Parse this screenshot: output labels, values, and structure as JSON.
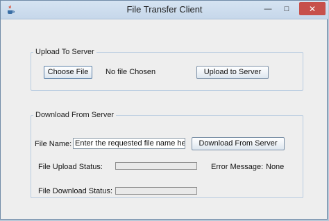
{
  "window": {
    "title": "File Transfer Client",
    "minimize_glyph": "—",
    "maximize_glyph": "□",
    "close_glyph": "✕"
  },
  "upload_section": {
    "legend": "Upload To Server",
    "choose_button": "Choose File",
    "file_status": "No file Chosen",
    "upload_button": "Upload to Server"
  },
  "download_section": {
    "legend": "Download From Server",
    "file_name_label": "File Name:",
    "file_name_value": "Enter the requested file name here",
    "download_button": "Download From Server",
    "upload_status_label": "File Upload Status:",
    "upload_progress": 0,
    "error_label": "Error Message:",
    "error_value": "None",
    "download_status_label": "File Download Status:",
    "download_progress": 0
  },
  "icons": {
    "app": "java-coffee-icon"
  },
  "colors": {
    "titlebar": "#c6d7ea",
    "close_button": "#c7504b",
    "panel_background": "#eeeeee",
    "group_border": "#b8cbe0"
  }
}
